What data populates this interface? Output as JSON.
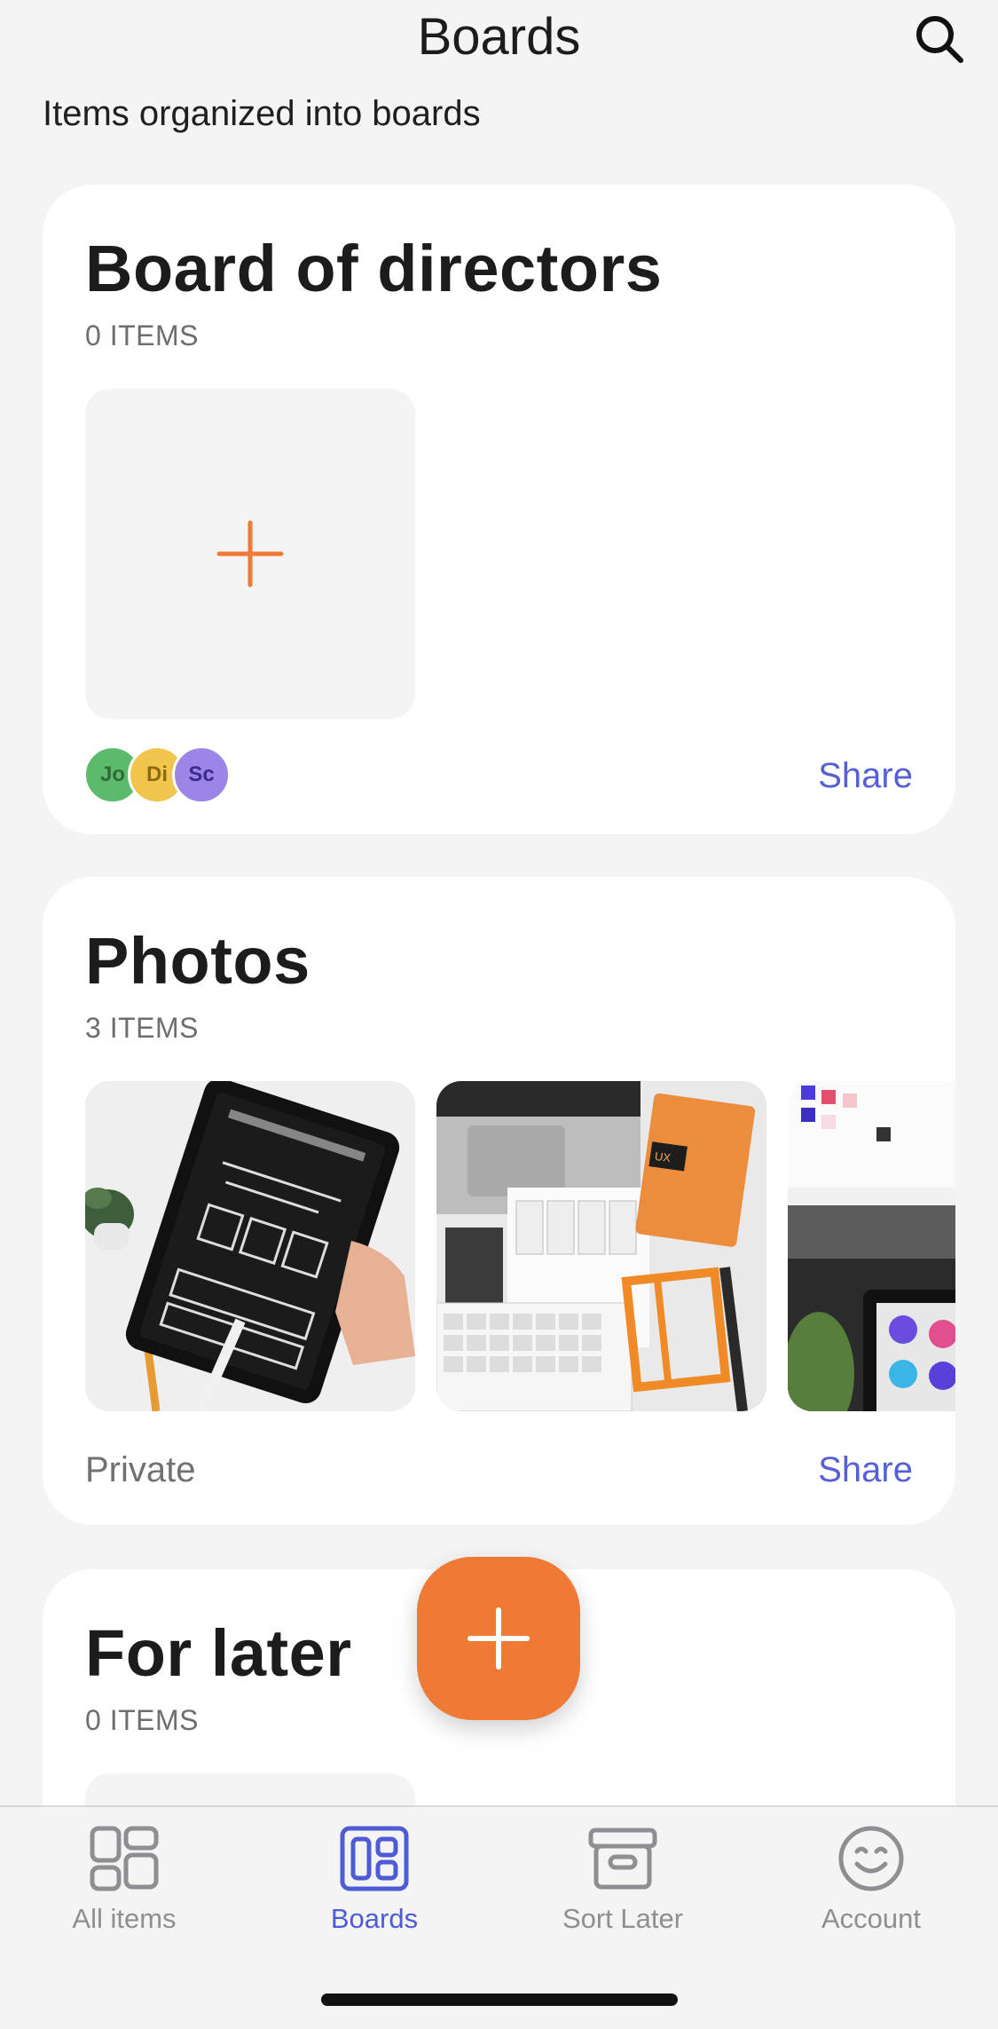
{
  "header": {
    "title": "Boards",
    "subtitle": "Items organized into boards",
    "search_icon": "search-icon"
  },
  "boards": [
    {
      "title": "Board of directors",
      "count": "0 ITEMS",
      "share_label": "Share",
      "members": [
        {
          "initials": "Jo",
          "color": "#5cba6c",
          "text_color": "#2f6b38"
        },
        {
          "initials": "Di",
          "color": "#f0c64c",
          "text_color": "#8a6a12"
        },
        {
          "initials": "Sc",
          "color": "#9b85e6",
          "text_color": "#3b2a8c"
        }
      ]
    },
    {
      "title": "Photos",
      "count": "3 ITEMS",
      "visibility": "Private",
      "share_label": "Share",
      "photos": [
        "tablet-wireframe-photo",
        "ux-sketchbook-photo",
        "color-palette-photo"
      ]
    },
    {
      "title": "For later",
      "count": "0 ITEMS"
    }
  ],
  "fab": {
    "icon": "plus-icon"
  },
  "tabbar": {
    "tabs": [
      {
        "label": "All items",
        "icon": "grid-icon",
        "active": false
      },
      {
        "label": "Boards",
        "icon": "boards-icon",
        "active": true
      },
      {
        "label": "Sort Later",
        "icon": "archive-box-icon",
        "active": false
      },
      {
        "label": "Account",
        "icon": "smiley-icon",
        "active": false
      }
    ]
  },
  "colors": {
    "accent": "#ef7a35",
    "link": "#5560d8",
    "active_tab": "#4f5bd5"
  }
}
